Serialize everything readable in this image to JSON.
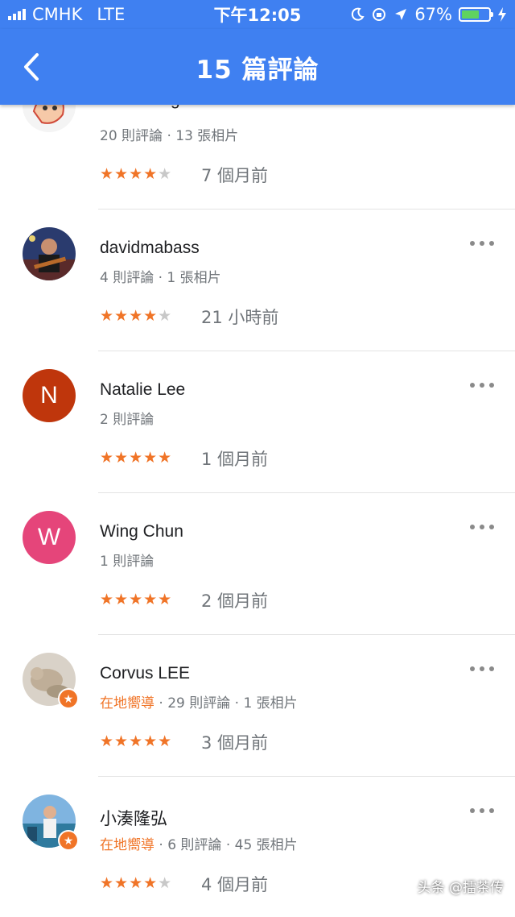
{
  "status": {
    "carrier": "CMHK",
    "network": "LTE",
    "time": "下午12:05",
    "battery": "67%",
    "battery_level": 0.67,
    "battery_color": "#5fd35f"
  },
  "header": {
    "title": "15 篇評論",
    "back_label": "<",
    "color": "#3f80f1"
  },
  "reviews": [
    {
      "name": "Wai Leong Ho",
      "meta": "20 則評論 · 13 張相片",
      "guide": "",
      "rating": 4,
      "time": "7 個月前",
      "avatar": "cartoon-avatar-icon"
    },
    {
      "name": "davidmabass",
      "meta": "4 則評論 · 1 張相片",
      "guide": "",
      "rating": 4,
      "time": "21 小時前",
      "avatar": "photo-avatar-icon"
    },
    {
      "name": "Natalie Lee",
      "meta": "2 則評論",
      "guide": "",
      "rating": 5,
      "time": "1 個月前",
      "initial": "N",
      "avatar_color": "#bf360c"
    },
    {
      "name": "Wing Chun",
      "meta": "1 則評論",
      "guide": "",
      "rating": 5,
      "time": "2 個月前",
      "initial": "W",
      "avatar_color": "#e5457a"
    },
    {
      "name": "Corvus LEE",
      "meta": " · 29 則評論 · 1 張相片",
      "guide": "在地嚮導",
      "rating": 5,
      "time": "3 個月前",
      "avatar": "photo-avatar-icon"
    },
    {
      "name": "小湊隆弘",
      "meta": " · 6 則評論 · 45 張相片",
      "guide": "在地嚮導",
      "rating": 4,
      "time": "4 個月前",
      "avatar": "photo-avatar-icon"
    }
  ],
  "watermark": "头条 @擂茶传",
  "accent": "#f07427"
}
